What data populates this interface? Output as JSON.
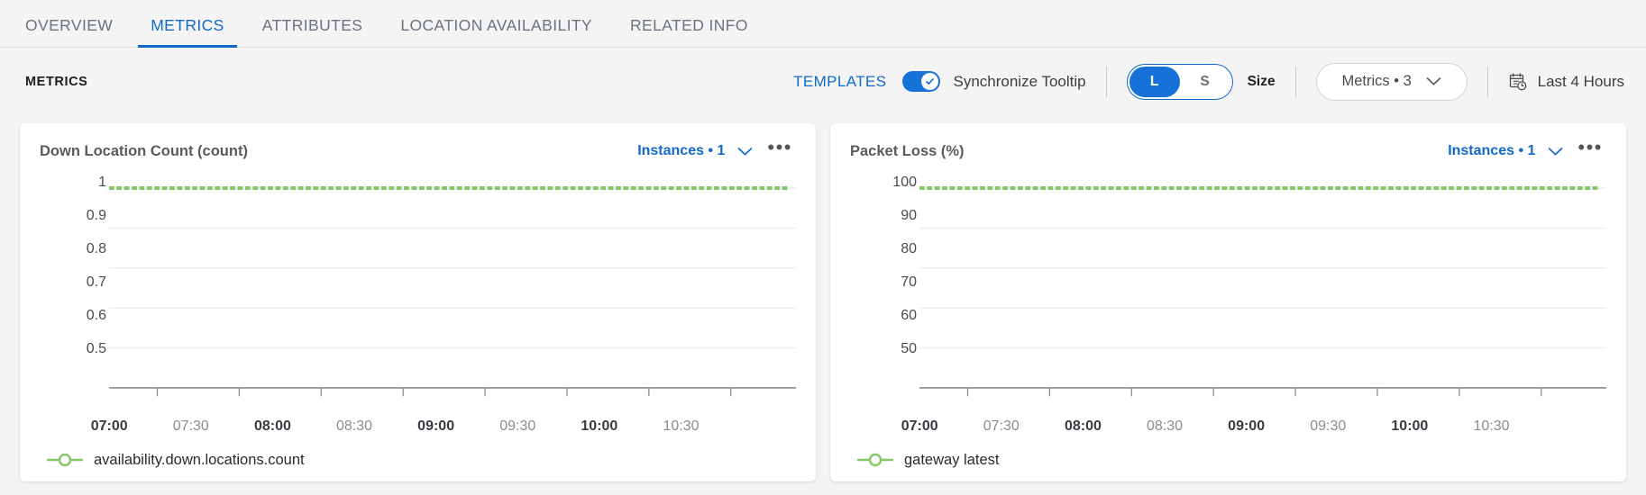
{
  "tabs": [
    {
      "label": "OVERVIEW",
      "active": false
    },
    {
      "label": "METRICS",
      "active": true
    },
    {
      "label": "ATTRIBUTES",
      "active": false
    },
    {
      "label": "LOCATION AVAILABILITY",
      "active": false
    },
    {
      "label": "RELATED INFO",
      "active": false
    }
  ],
  "toolbar": {
    "title": "METRICS",
    "templates_label": "TEMPLATES",
    "sync_tooltip_label": "Synchronize Tooltip",
    "sync_tooltip_on": true,
    "size_options": [
      "L",
      "S"
    ],
    "size_selected": "L",
    "size_label": "Size",
    "metrics_select_value": "Metrics • 3",
    "time_range_label": "Last 4 Hours",
    "accent_color": "#1269c9",
    "toggle_on_color": "#1672d8"
  },
  "cards": [
    {
      "title": "Down Location Count (count)",
      "instances_label": "Instances • 1",
      "menu_label": "•••",
      "legend_label": "availability.down.locations.count",
      "series_color": "#84c868"
    },
    {
      "title": "Packet Loss (%)",
      "instances_label": "Instances • 1",
      "menu_label": "•••",
      "legend_label": "gateway latest",
      "series_color": "#84c868"
    }
  ],
  "chart_data": [
    {
      "type": "line",
      "title": "Down Location Count (count)",
      "xlabel": "",
      "ylabel": "count",
      "ylim": [
        0.5,
        1.0
      ],
      "yticks": [
        1,
        0.9,
        0.8,
        0.7,
        0.6,
        0.5
      ],
      "ytick_labels": [
        "1",
        "0.9",
        "0.8",
        "0.7",
        "0.6",
        "0.5"
      ],
      "xticks": [
        "07:00",
        "07:30",
        "08:00",
        "08:30",
        "09:00",
        "09:30",
        "10:00",
        "10:30"
      ],
      "xtick_bold": [
        true,
        false,
        true,
        false,
        true,
        false,
        true,
        false
      ],
      "grid": true,
      "legend_position": "bottom-left",
      "series": [
        {
          "name": "availability.down.locations.count",
          "color": "#84c868",
          "x": [
            "07:00",
            "07:30",
            "08:00",
            "08:30",
            "09:00",
            "09:30",
            "10:00",
            "10:30"
          ],
          "values": [
            1,
            1,
            1,
            1,
            1,
            1,
            1,
            1
          ]
        }
      ]
    },
    {
      "type": "line",
      "title": "Packet Loss (%)",
      "xlabel": "",
      "ylabel": "%",
      "ylim": [
        50,
        100
      ],
      "yticks": [
        100,
        90,
        80,
        70,
        60,
        50
      ],
      "ytick_labels": [
        "100",
        "90",
        "80",
        "70",
        "60",
        "50"
      ],
      "xticks": [
        "07:00",
        "07:30",
        "08:00",
        "08:30",
        "09:00",
        "09:30",
        "10:00",
        "10:30"
      ],
      "xtick_bold": [
        true,
        false,
        true,
        false,
        true,
        false,
        true,
        false
      ],
      "grid": true,
      "legend_position": "bottom-left",
      "series": [
        {
          "name": "gateway latest",
          "color": "#84c868",
          "x": [
            "07:00",
            "07:30",
            "08:00",
            "08:30",
            "09:00",
            "09:30",
            "10:00",
            "10:30"
          ],
          "values": [
            100,
            100,
            100,
            100,
            100,
            100,
            100,
            100
          ]
        }
      ]
    }
  ]
}
